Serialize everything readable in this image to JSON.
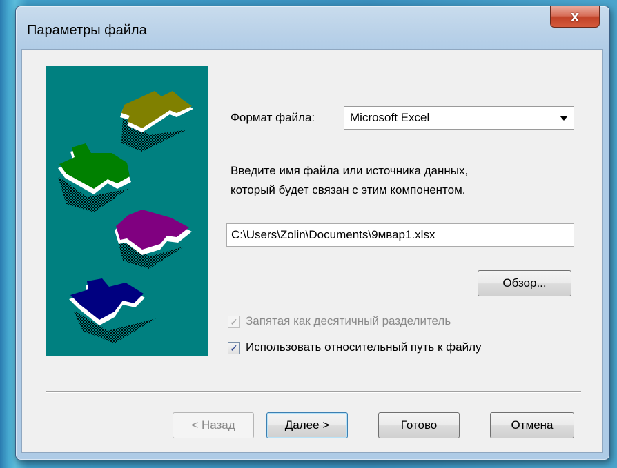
{
  "window": {
    "title": "Параметры файла",
    "close_glyph": "x"
  },
  "form": {
    "format_label": "Формат файла:",
    "format_value": "Microsoft Excel",
    "instruction_line1": "Введите имя файла или источника данных,",
    "instruction_line2": "который будет связан с этим компонентом.",
    "file_path": "C:\\Users\\Zolin\\Documents\\9мвар1.xlsx",
    "browse_label": "Обзор...",
    "decimal_comma_label": "Запятая как десятичный разделитель",
    "decimal_comma_checked": true,
    "decimal_comma_enabled": false,
    "relative_path_label": "Использовать относительный путь к файлу",
    "relative_path_checked": true
  },
  "footer": {
    "back_label": "< Назад",
    "next_label": "Далее >",
    "finish_label": "Готово",
    "cancel_label": "Отмена"
  },
  "illustration": {
    "background": "#008080",
    "pieces": [
      "olive-puzzle-piece",
      "green-puzzle-piece",
      "purple-puzzle-piece",
      "navy-puzzle-piece"
    ],
    "colors": [
      "#808000",
      "#008000",
      "#800080",
      "#000080"
    ]
  },
  "colors": {
    "close_button": "#c24328",
    "default_button_border": "#3c7fb1",
    "checkbox_mark": "#233e8c"
  },
  "icons": {
    "close": "close-icon",
    "dropdown": "chevron-down-icon",
    "check": "checkmark-icon"
  }
}
